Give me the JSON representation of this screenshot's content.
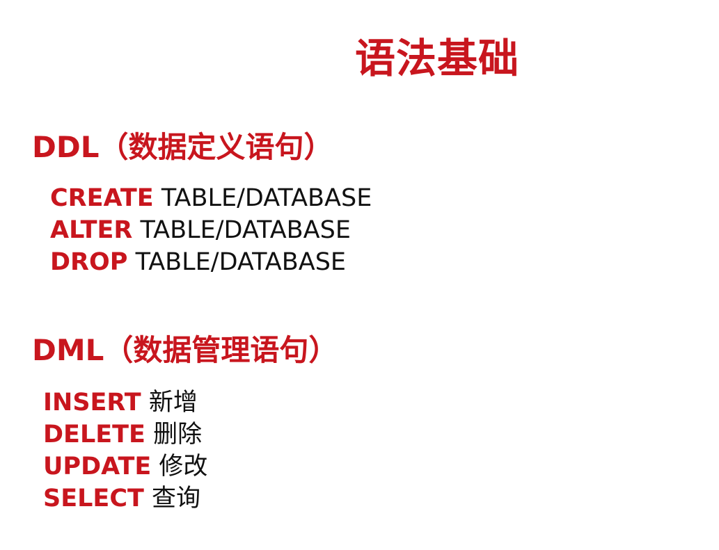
{
  "slide": {
    "title": "语法基础",
    "accent_color": "#c8161e",
    "text_color": "#111111"
  },
  "ddl": {
    "heading": "DDL（数据定义语句）",
    "items": [
      {
        "keyword": "CREATE",
        "text": "TABLE/DATABASE"
      },
      {
        "keyword": "ALTER",
        "text": "TABLE/DATABASE"
      },
      {
        "keyword": "DROP",
        "text": "TABLE/DATABASE"
      }
    ]
  },
  "dml": {
    "heading": "DML（数据管理语句）",
    "items": [
      {
        "keyword": "INSERT",
        "text": "新增"
      },
      {
        "keyword": "DELETE",
        "text": "删除"
      },
      {
        "keyword": "UPDATE",
        "text": "修改"
      },
      {
        "keyword": "SELECT",
        "text": "查询"
      }
    ]
  }
}
